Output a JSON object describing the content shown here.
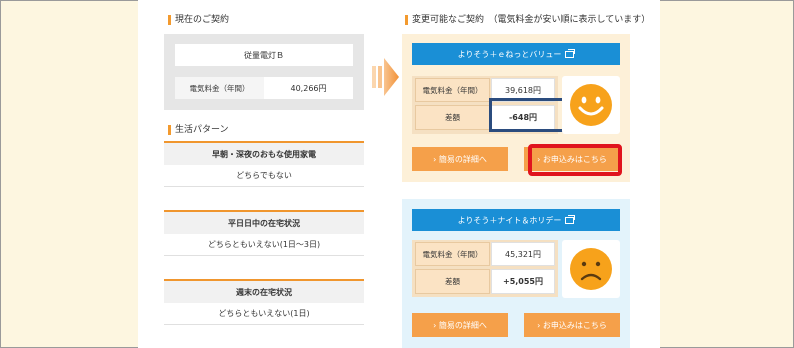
{
  "current": {
    "section_title": "現在のご契約",
    "plan_name": "従量電灯Ｂ",
    "fee_label": "電気料金（年間）",
    "fee_value": "40,266円"
  },
  "lifestyle": {
    "section_title": "生活パターン",
    "items": [
      {
        "heading": "早朝・深夜のおもな使用家電",
        "value": "どちらでもない"
      },
      {
        "heading": "平日日中の在宅状況",
        "value": "どちらともいえない(1日～3日)"
      },
      {
        "heading": "週末の在宅状況",
        "value": "どちらともいえない(1日)"
      }
    ]
  },
  "changeable": {
    "section_title": "変更可能なご契約　（電気料金が安い順に表示しています）"
  },
  "plans": [
    {
      "name": "よりそう＋ｅねっとバリュー",
      "fee_label": "電気料金（年間）",
      "fee_value": "39,618円",
      "diff_label": "差額",
      "diff_value": "-648円",
      "detail_label": "› 簡易の詳細へ",
      "apply_label": "› お申込みはこちら",
      "face": "happy-face-icon"
    },
    {
      "name": "よりそう＋ナイト＆ホリデー",
      "fee_label": "電気料金（年間）",
      "fee_value": "45,321円",
      "diff_label": "差額",
      "diff_value": "+5,055円",
      "detail_label": "› 簡易の詳細へ",
      "apply_label": "› お申込みはこちら",
      "face": "sad-face-icon"
    }
  ],
  "colors": {
    "accent": "#f39a2e",
    "plan_button": "#1a8fd6",
    "highlight_red": "#e0141e",
    "highlight_navy": "#2b4c7e",
    "face_orange": "#f7a21b"
  }
}
